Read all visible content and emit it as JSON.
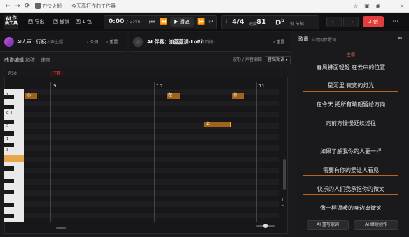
{
  "browser": {
    "title": "刀快火起 - 一今天高打作曲工作器"
  },
  "toolbar": {
    "logo": "AI 作曲工具",
    "btn1": "回 导出",
    "btn2": "回 撤销",
    "btn3": "回 1 包"
  },
  "transport": {
    "current": "0:00",
    "total": "/ 2:46",
    "play_label": "▶ 播放"
  },
  "meter": {
    "time_sig": "4/4",
    "tempo_label": "速度",
    "tempo": "81",
    "key": "D",
    "key_sup": "b",
    "beat_label": "拍 节拍"
  },
  "header_right": {
    "red_label": "2 创"
  },
  "track_left": {
    "name": "AI人声 · 行板",
    "subtitle": "人声主唱",
    "ctrl1": "公调",
    "ctrl2": "重置"
  },
  "track_right": {
    "name": "AI 伴奏：淡蓝蓝调-LoFi",
    "subtitle": "(改变风格)",
    "ctrl": "重置"
  },
  "sub_toolbar": {
    "left1": "曲谱编辑",
    "left2": "和弦",
    "left3": "速度",
    "right1": "波形 / 声音编辑",
    "right2": "音高微调"
  },
  "roll": {
    "lane_label": "R50",
    "marker": "下载",
    "bars": [
      "9",
      "10",
      "11"
    ]
  },
  "piano_keys": [
    "1",
    "C 4",
    "5",
    "1",
    "3"
  ],
  "notes": [
    "心",
    "在",
    "你",
    "上"
  ],
  "lyrics_panel": {
    "title": "歌词",
    "subtitle": "自动同步歌词",
    "section": "主歌",
    "lines": [
      "春风拂面轻轻 在云中的位置",
      "星河里 寂寞的灯光",
      "在今天 把所有晴朗留给方向",
      "向前方慢慢延续过往",
      "如果了解我你的人要一样",
      "需要有你的爱让人看见",
      "快乐的人们我承担你的微笑",
      "像一样温暖的身边离微笑"
    ],
    "btn_left": "AI 重写歌词",
    "btn_right": "AI 继续创作"
  }
}
